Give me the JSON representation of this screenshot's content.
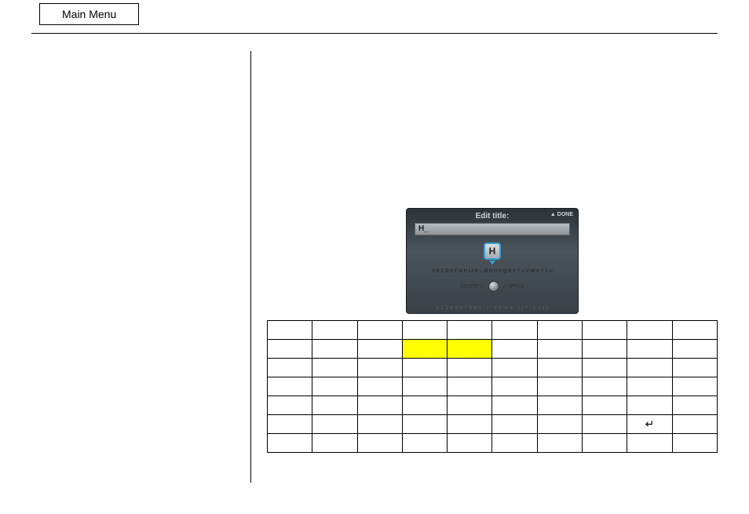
{
  "header": {
    "main_menu_label": "Main Menu"
  },
  "device": {
    "title": "Edit title:",
    "done_label": "▲ DONE",
    "input_value": "H_",
    "highlighted_key": "H",
    "alphabet": "A B C D E F G H I J K L M N O P Q R S T U V W X Y Z ↵",
    "knob_left": "DELETE ◁",
    "knob_right": "▷ SPACE",
    "down_arrow": "▽",
    "numbers_row": "1 2 3 4 5 6 7 8 9 0 - ! \" # $ % & ' ( ) ^ / < > { }"
  },
  "char_table": {
    "rows": [
      [
        "",
        "",
        "",
        "",
        "",
        "",
        "",
        "",
        "",
        ""
      ],
      [
        "",
        "",
        "",
        "",
        "",
        "",
        "",
        "",
        "",
        ""
      ],
      [
        "",
        "",
        "",
        "",
        "",
        "",
        "",
        "",
        "",
        ""
      ],
      [
        "",
        "",
        "",
        "",
        "",
        "",
        "",
        "",
        "",
        ""
      ],
      [
        "",
        "",
        "",
        "",
        "",
        "",
        "",
        "",
        "",
        ""
      ],
      [
        "",
        "",
        "",
        "",
        "",
        "",
        "",
        "",
        "↵",
        ""
      ],
      [
        "",
        "",
        "",
        "",
        "",
        "",
        "",
        "",
        "",
        ""
      ]
    ],
    "highlight_row": 1,
    "highlight_cols": [
      3,
      4
    ]
  }
}
